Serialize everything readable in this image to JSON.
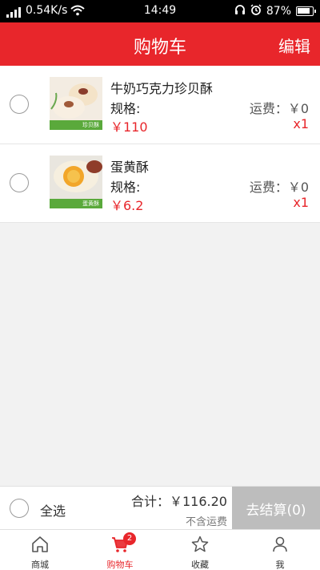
{
  "status_bar": {
    "speed": "0.54K/s",
    "time": "14:49",
    "battery": "87%"
  },
  "header": {
    "title": "购物车",
    "edit_label": "编辑"
  },
  "cart": {
    "items": [
      {
        "name": "牛奶巧克力珍贝酥",
        "spec_label": "规格:",
        "price": "￥110",
        "shipping": "运费：￥0",
        "quantity": "x1",
        "image_band_text": "珍贝酥"
      },
      {
        "name": "蛋黄酥",
        "spec_label": "规格:",
        "price": "￥6.2",
        "shipping": "运费：￥0",
        "quantity": "x1",
        "image_band_text": "蛋黄酥"
      }
    ]
  },
  "footer": {
    "select_all_label": "全选",
    "total_label": "合计：￥116.20",
    "shipping_note": "不含运费",
    "checkout_label": "去结算(0)"
  },
  "tabbar": {
    "tabs": [
      {
        "label": "商城",
        "icon": "home-icon"
      },
      {
        "label": "购物车",
        "icon": "cart-icon",
        "badge": "2",
        "active": true
      },
      {
        "label": "收藏",
        "icon": "star-icon"
      },
      {
        "label": "我",
        "icon": "person-icon"
      }
    ]
  },
  "colors": {
    "brand_red": "#e8262b",
    "checkout_disabled": "#bdbdbd",
    "background": "#f2f2f2"
  }
}
